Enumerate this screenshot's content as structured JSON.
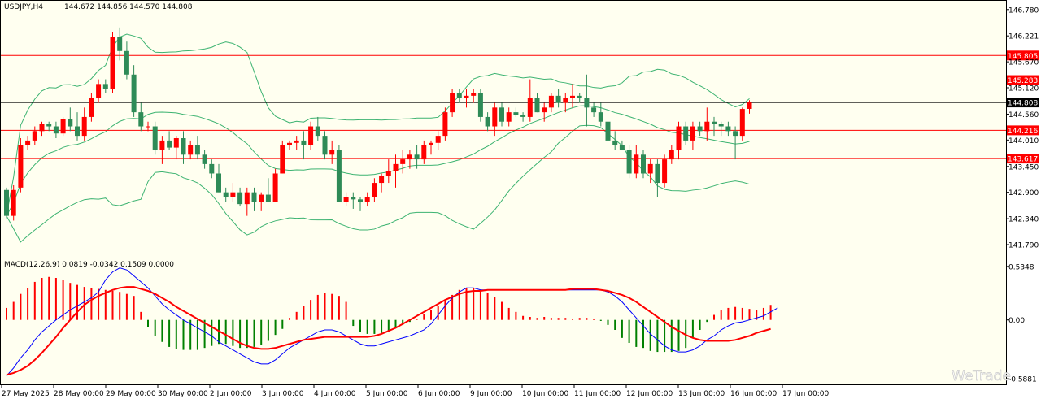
{
  "header": {
    "symbol": "USDJPY,H4",
    "ohlc": "144.672 144.856 144.570 144.808"
  },
  "macd_header": "MACD(12,26,9) 0.0819 -0.0342 0.1509 0.0000",
  "watermark": "WeTrade",
  "colors": {
    "bg": "#fffff0",
    "bull": "#ff0000",
    "bear": "#2e8b57",
    "band": "#3cb371",
    "level": "#ff0000",
    "price_line": "#000000",
    "macd_hist_pos": "#ff0000",
    "macd_hist_neg": "#008000",
    "macd_line": "#0000ff",
    "signal_line": "#ff0000"
  },
  "chart_data": {
    "type": "candlestick",
    "title": "USDJPY,H4",
    "price_axis": {
      "ticks": [
        "146.780",
        "146.221",
        "145.670",
        "145.120",
        "144.560",
        "144.010",
        "143.450",
        "142.900",
        "142.340",
        "141.790"
      ],
      "range": [
        141.6,
        146.88
      ]
    },
    "macd_axis": {
      "ticks": [
        "0.5348",
        "0.00",
        "-0.5881"
      ],
      "range": [
        -0.62,
        0.55
      ]
    },
    "time_axis": [
      "27 May 2025",
      "28 May 00:00",
      "29 May 00:00",
      "30 May 00:00",
      "2 Jun 00:00",
      "3 Jun 00:00",
      "4 Jun 00:00",
      "5 Jun 00:00",
      "6 Jun 00:00",
      "9 Jun 00:00",
      "10 Jun 00:00",
      "11 Jun 00:00",
      "12 Jun 00:00",
      "13 Jun 00:00",
      "16 Jun 00:00",
      "17 Jun 00:00"
    ],
    "levels": [
      {
        "value": "145.805",
        "color": "#ff0000"
      },
      {
        "value": "145.283",
        "color": "#ff0000"
      },
      {
        "value": "144.808",
        "color": "#000000"
      },
      {
        "value": "144.216",
        "color": "#ff0000"
      },
      {
        "value": "143.617",
        "color": "#ff0000"
      }
    ],
    "candles": [
      [
        142.95,
        143.0,
        142.35,
        142.4
      ],
      [
        142.4,
        143.05,
        142.3,
        142.95
      ],
      [
        143.0,
        144.05,
        142.9,
        143.9
      ],
      [
        143.9,
        144.1,
        143.8,
        144.0
      ],
      [
        144.0,
        144.3,
        143.9,
        144.2
      ],
      [
        144.2,
        144.4,
        144.1,
        144.35
      ],
      [
        144.35,
        144.4,
        144.2,
        144.3
      ],
      [
        144.3,
        144.4,
        144.05,
        144.15
      ],
      [
        144.15,
        144.5,
        144.1,
        144.45
      ],
      [
        144.45,
        144.7,
        144.2,
        144.3
      ],
      [
        144.3,
        144.6,
        144.0,
        144.1
      ],
      [
        144.1,
        144.7,
        144.0,
        144.5
      ],
      [
        144.5,
        145.0,
        144.4,
        144.9
      ],
      [
        144.9,
        145.3,
        144.8,
        145.2
      ],
      [
        145.2,
        145.3,
        145.0,
        145.1
      ],
      [
        145.1,
        146.3,
        145.0,
        146.2
      ],
      [
        146.2,
        146.4,
        145.7,
        145.9
      ],
      [
        145.9,
        146.1,
        145.3,
        145.4
      ],
      [
        145.4,
        145.6,
        144.5,
        144.6
      ],
      [
        144.6,
        144.8,
        144.2,
        144.3
      ],
      [
        144.3,
        144.4,
        144.2,
        144.3
      ],
      [
        144.3,
        144.4,
        143.7,
        143.8
      ],
      [
        143.8,
        144.1,
        143.5,
        144.0
      ],
      [
        144.0,
        144.2,
        143.8,
        143.85
      ],
      [
        143.85,
        144.1,
        143.6,
        144.05
      ],
      [
        144.05,
        144.2,
        143.5,
        143.7
      ],
      [
        143.7,
        144.0,
        143.6,
        143.9
      ],
      [
        143.9,
        144.1,
        143.6,
        143.7
      ],
      [
        143.7,
        143.8,
        143.4,
        143.5
      ],
      [
        143.5,
        143.6,
        143.2,
        143.3
      ],
      [
        143.3,
        143.5,
        142.9,
        142.9
      ],
      [
        142.9,
        143.0,
        142.7,
        142.8
      ],
      [
        142.8,
        143.1,
        142.7,
        142.9
      ],
      [
        142.9,
        143.0,
        142.6,
        142.65
      ],
      [
        142.65,
        143.0,
        142.4,
        142.9
      ],
      [
        142.9,
        143.0,
        142.5,
        142.7
      ],
      [
        142.7,
        142.9,
        142.5,
        142.85
      ],
      [
        142.85,
        143.2,
        142.7,
        142.7
      ],
      [
        142.7,
        143.4,
        142.7,
        143.3
      ],
      [
        143.3,
        144.0,
        143.3,
        143.9
      ],
      [
        143.9,
        144.0,
        143.8,
        143.95
      ],
      [
        143.95,
        144.1,
        143.8,
        144.0
      ],
      [
        144.0,
        144.2,
        143.6,
        143.9
      ],
      [
        143.9,
        144.4,
        143.8,
        144.3
      ],
      [
        144.3,
        144.5,
        144.0,
        144.1
      ],
      [
        144.1,
        144.2,
        143.6,
        143.7
      ],
      [
        143.7,
        144.0,
        143.5,
        143.8
      ],
      [
        143.8,
        143.9,
        142.8,
        142.7
      ],
      [
        142.7,
        142.9,
        142.6,
        142.8
      ],
      [
        142.8,
        142.9,
        142.55,
        142.75
      ],
      [
        142.75,
        142.8,
        142.5,
        142.7
      ],
      [
        142.7,
        142.9,
        142.6,
        142.8
      ],
      [
        142.8,
        143.2,
        142.7,
        143.1
      ],
      [
        143.1,
        143.3,
        142.9,
        143.25
      ],
      [
        143.25,
        143.6,
        143.1,
        143.35
      ],
      [
        143.35,
        143.7,
        143.0,
        143.5
      ],
      [
        143.5,
        143.8,
        143.3,
        143.6
      ],
      [
        143.6,
        143.8,
        143.4,
        143.7
      ],
      [
        143.7,
        143.9,
        143.4,
        143.6
      ],
      [
        143.6,
        144.0,
        143.5,
        143.9
      ],
      [
        143.9,
        144.0,
        143.7,
        143.95
      ],
      [
        143.95,
        144.2,
        143.8,
        144.1
      ],
      [
        144.1,
        144.7,
        144.0,
        144.6
      ],
      [
        144.6,
        145.1,
        144.5,
        145.0
      ],
      [
        145.0,
        145.1,
        144.8,
        144.9
      ],
      [
        144.9,
        145.1,
        144.7,
        144.95
      ],
      [
        144.95,
        145.1,
        144.8,
        145.0
      ],
      [
        145.0,
        145.1,
        144.4,
        144.5
      ],
      [
        144.5,
        144.6,
        144.2,
        144.3
      ],
      [
        144.3,
        144.8,
        144.1,
        144.7
      ],
      [
        144.7,
        144.8,
        144.3,
        144.4
      ],
      [
        144.4,
        144.7,
        144.3,
        144.6
      ],
      [
        144.6,
        144.7,
        144.5,
        144.55
      ],
      [
        144.55,
        144.6,
        144.4,
        144.5
      ],
      [
        144.5,
        145.3,
        144.4,
        144.9
      ],
      [
        144.9,
        145.0,
        144.6,
        144.6
      ],
      [
        144.6,
        144.8,
        144.4,
        144.7
      ],
      [
        144.7,
        145.0,
        144.6,
        144.95
      ],
      [
        144.95,
        145.1,
        144.7,
        144.8
      ],
      [
        144.8,
        145.0,
        144.6,
        144.9
      ],
      [
        144.9,
        145.2,
        144.7,
        144.95
      ],
      [
        144.95,
        145.0,
        144.8,
        144.9
      ],
      [
        144.9,
        145.4,
        144.3,
        144.7
      ],
      [
        144.7,
        144.8,
        144.5,
        144.6
      ],
      [
        144.6,
        144.8,
        144.3,
        144.4
      ],
      [
        144.4,
        144.6,
        143.9,
        144.0
      ],
      [
        144.0,
        144.2,
        143.8,
        143.9
      ],
      [
        143.9,
        144.0,
        143.8,
        143.8
      ],
      [
        143.8,
        143.9,
        143.2,
        143.3
      ],
      [
        143.3,
        143.9,
        143.2,
        143.7
      ],
      [
        143.7,
        143.8,
        143.2,
        143.3
      ],
      [
        143.3,
        143.6,
        143.1,
        143.5
      ],
      [
        143.5,
        143.6,
        142.8,
        143.1
      ],
      [
        143.1,
        143.7,
        143.0,
        143.6
      ],
      [
        143.6,
        143.9,
        143.5,
        143.8
      ],
      [
        143.8,
        144.4,
        143.6,
        144.3
      ],
      [
        144.3,
        144.4,
        143.9,
        144.0
      ],
      [
        144.0,
        144.4,
        143.8,
        144.3
      ],
      [
        144.3,
        144.4,
        144.1,
        144.2
      ],
      [
        144.2,
        144.7,
        144.0,
        144.4
      ],
      [
        144.4,
        144.5,
        144.1,
        144.35
      ],
      [
        144.35,
        144.4,
        144.1,
        144.3
      ],
      [
        144.3,
        144.4,
        144.1,
        144.2
      ],
      [
        144.2,
        144.3,
        143.6,
        144.1
      ],
      [
        144.1,
        144.7,
        144.0,
        144.67
      ],
      [
        144.672,
        144.856,
        144.57,
        144.808
      ]
    ],
    "macd_hist": [
      0.12,
      0.18,
      0.26,
      0.32,
      0.38,
      0.42,
      0.43,
      0.42,
      0.4,
      0.37,
      0.35,
      0.33,
      0.32,
      0.31,
      0.3,
      0.29,
      0.28,
      0.26,
      0.24,
      0.08,
      -0.07,
      -0.16,
      -0.22,
      -0.27,
      -0.29,
      -0.3,
      -0.3,
      -0.3,
      -0.28,
      -0.26,
      -0.24,
      -0.24,
      -0.26,
      -0.28,
      -0.28,
      -0.27,
      -0.25,
      -0.21,
      -0.15,
      -0.09,
      0.02,
      0.08,
      0.14,
      0.2,
      0.25,
      0.27,
      0.26,
      0.24,
      0.18,
      -0.06,
      -0.12,
      -0.14,
      -0.14,
      -0.13,
      -0.11,
      -0.08,
      -0.05,
      -0.02,
      0.01,
      0.06,
      0.1,
      0.14,
      0.19,
      0.25,
      0.3,
      0.32,
      0.32,
      0.3,
      0.27,
      0.23,
      0.18,
      0.12,
      0.08,
      0.04,
      0.03,
      0.02,
      0.03,
      0.02,
      0.02,
      0.02,
      0.01,
      0.02,
      0.02,
      0.01,
      -0.01,
      -0.05,
      -0.1,
      -0.18,
      -0.23,
      -0.27,
      -0.28,
      -0.31,
      -0.32,
      -0.32,
      -0.32,
      -0.31,
      -0.28,
      -0.18,
      -0.1,
      -0.02,
      0.05,
      0.1,
      0.12,
      0.13,
      0.12,
      0.11,
      0.1,
      0.12,
      0.15
    ],
    "macd_line": [
      -0.56,
      -0.48,
      -0.38,
      -0.3,
      -0.2,
      -0.12,
      -0.06,
      0.0,
      0.05,
      0.1,
      0.14,
      0.18,
      0.22,
      0.28,
      0.4,
      0.48,
      0.52,
      0.5,
      0.44,
      0.38,
      0.32,
      0.24,
      0.16,
      0.1,
      0.05,
      0.0,
      -0.04,
      -0.08,
      -0.12,
      -0.16,
      -0.22,
      -0.26,
      -0.3,
      -0.34,
      -0.38,
      -0.42,
      -0.44,
      -0.44,
      -0.4,
      -0.34,
      -0.28,
      -0.24,
      -0.2,
      -0.16,
      -0.12,
      -0.1,
      -0.1,
      -0.12,
      -0.16,
      -0.2,
      -0.24,
      -0.26,
      -0.26,
      -0.24,
      -0.22,
      -0.2,
      -0.18,
      -0.16,
      -0.13,
      -0.1,
      -0.04,
      0.05,
      0.14,
      0.22,
      0.28,
      0.32,
      0.32,
      0.3,
      0.3,
      0.3,
      0.3,
      0.3,
      0.3,
      0.3,
      0.3,
      0.3,
      0.3,
      0.3,
      0.3,
      0.3,
      0.3,
      0.3,
      0.3,
      0.3,
      0.3,
      0.28,
      0.24,
      0.18,
      0.1,
      0.02,
      -0.06,
      -0.14,
      -0.2,
      -0.26,
      -0.3,
      -0.32,
      -0.32,
      -0.3,
      -0.26,
      -0.2,
      -0.16,
      -0.1,
      -0.06,
      -0.03,
      -0.02,
      0.0,
      0.02,
      0.04,
      0.08,
      0.12
    ],
    "signal_line": [
      -0.55,
      -0.53,
      -0.5,
      -0.46,
      -0.4,
      -0.33,
      -0.25,
      -0.17,
      -0.08,
      0.0,
      0.08,
      0.15,
      0.2,
      0.24,
      0.27,
      0.3,
      0.32,
      0.33,
      0.33,
      0.31,
      0.29,
      0.26,
      0.22,
      0.18,
      0.13,
      0.09,
      0.05,
      0.01,
      -0.03,
      -0.07,
      -0.11,
      -0.15,
      -0.19,
      -0.23,
      -0.26,
      -0.28,
      -0.29,
      -0.29,
      -0.28,
      -0.26,
      -0.24,
      -0.22,
      -0.2,
      -0.19,
      -0.18,
      -0.17,
      -0.17,
      -0.17,
      -0.17,
      -0.17,
      -0.17,
      -0.17,
      -0.16,
      -0.14,
      -0.11,
      -0.08,
      -0.04,
      0.0,
      0.04,
      0.08,
      0.12,
      0.16,
      0.2,
      0.23,
      0.26,
      0.28,
      0.29,
      0.29,
      0.3,
      0.3,
      0.3,
      0.3,
      0.3,
      0.3,
      0.3,
      0.3,
      0.3,
      0.3,
      0.3,
      0.3,
      0.31,
      0.31,
      0.31,
      0.31,
      0.3,
      0.29,
      0.27,
      0.25,
      0.22,
      0.18,
      0.13,
      0.08,
      0.03,
      -0.02,
      -0.07,
      -0.11,
      -0.15,
      -0.18,
      -0.2,
      -0.21,
      -0.21,
      -0.21,
      -0.21,
      -0.2,
      -0.18,
      -0.16,
      -0.13,
      -0.11,
      -0.09
    ]
  }
}
